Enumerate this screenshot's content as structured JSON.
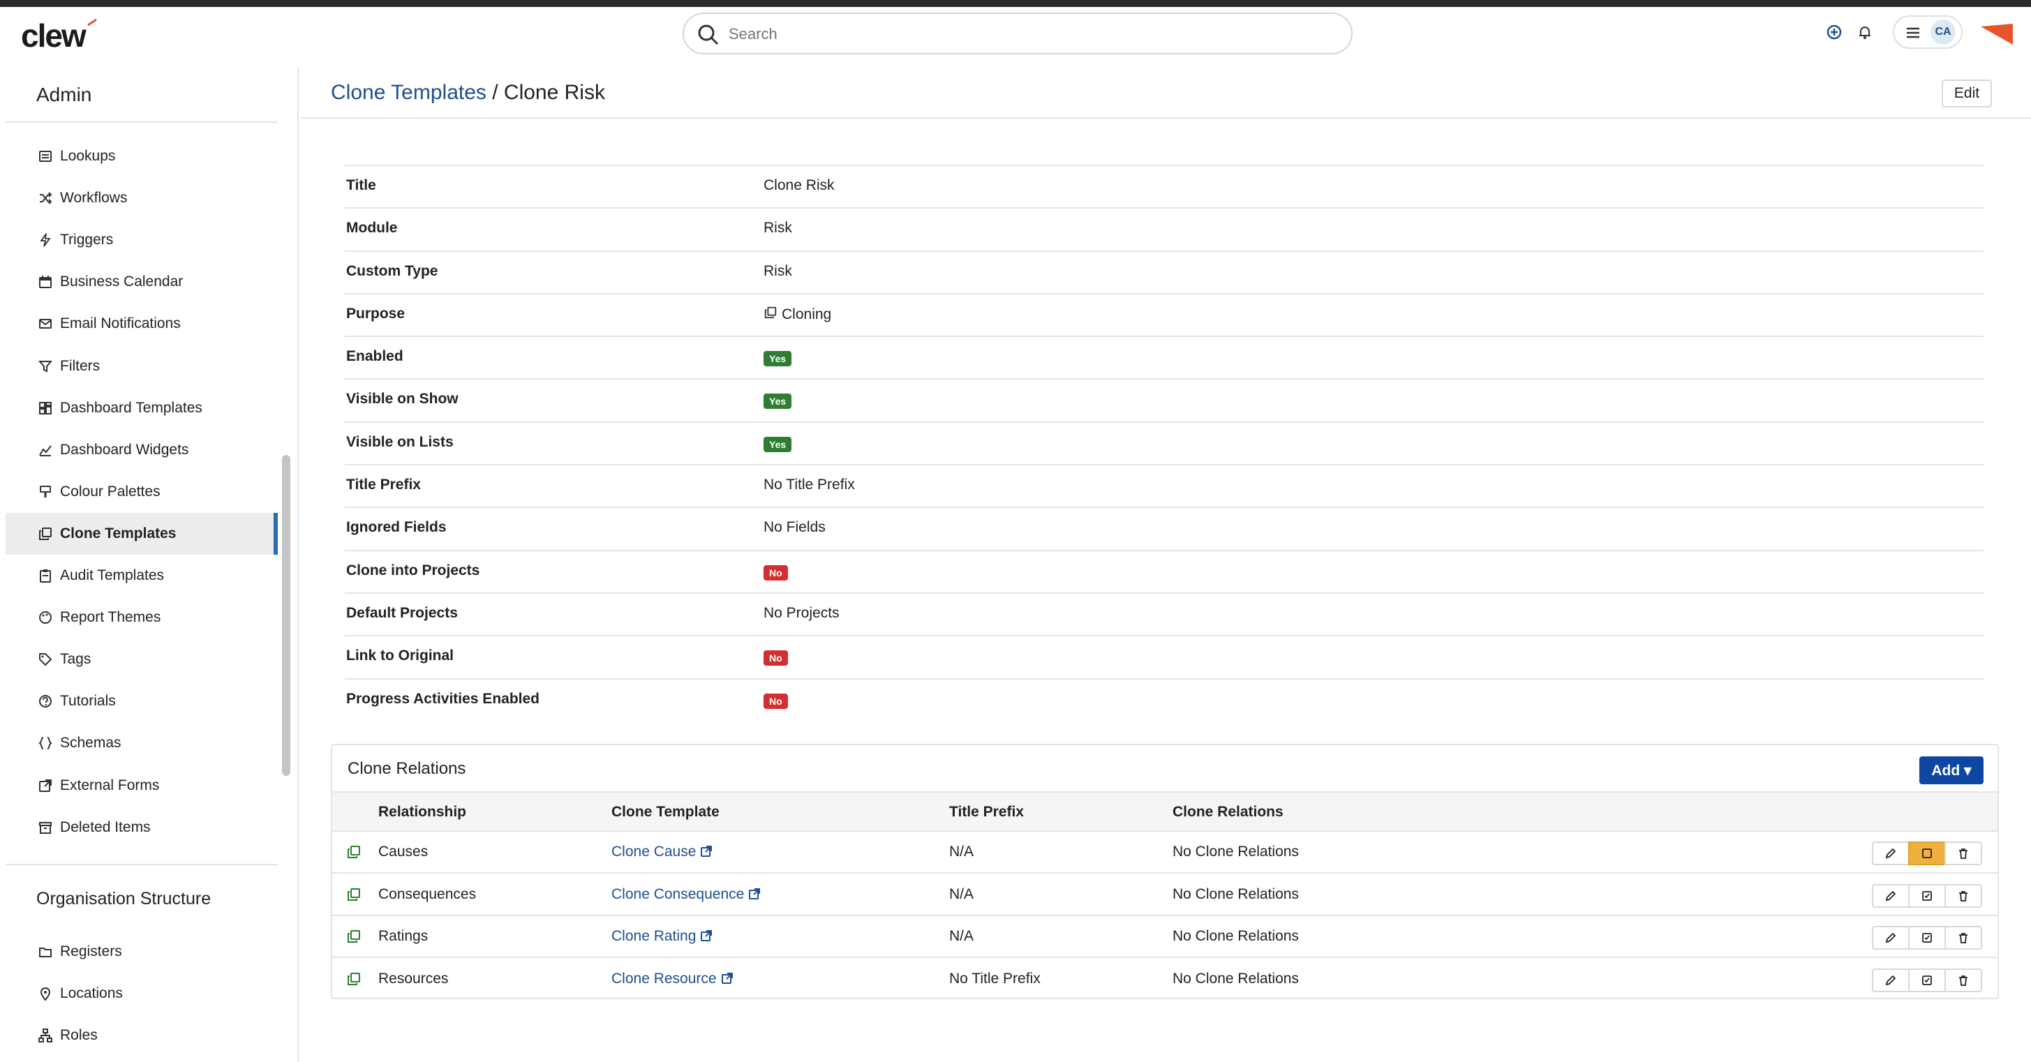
{
  "app": {
    "logo": "clew",
    "accent": "#1e4f8f",
    "brand_color": "#e8532c"
  },
  "search": {
    "placeholder": "Search"
  },
  "topbar": {
    "avatar_initials": "CA"
  },
  "sidebar": {
    "admin_heading": "Admin",
    "items": [
      {
        "label": "Lookups",
        "icon": "lookups-icon"
      },
      {
        "label": "Workflows",
        "icon": "shuffle-icon"
      },
      {
        "label": "Triggers",
        "icon": "lightning-icon"
      },
      {
        "label": "Business Calendar",
        "icon": "calendar-icon"
      },
      {
        "label": "Email Notifications",
        "icon": "envelope-icon"
      },
      {
        "label": "Filters",
        "icon": "funnel-icon"
      },
      {
        "label": "Dashboard Templates",
        "icon": "dashboard-icon"
      },
      {
        "label": "Dashboard Widgets",
        "icon": "chart-icon"
      },
      {
        "label": "Colour Palettes",
        "icon": "paint-icon"
      },
      {
        "label": "Clone Templates",
        "icon": "clone-icon",
        "active": true
      },
      {
        "label": "Audit Templates",
        "icon": "clipboard-icon"
      },
      {
        "label": "Report Themes",
        "icon": "palette-icon"
      },
      {
        "label": "Tags",
        "icon": "tag-icon"
      },
      {
        "label": "Tutorials",
        "icon": "question-icon"
      },
      {
        "label": "Schemas",
        "icon": "braces-icon"
      },
      {
        "label": "External Forms",
        "icon": "external-link-icon"
      },
      {
        "label": "Deleted Items",
        "icon": "archive-icon"
      }
    ],
    "org_heading": "Organisation Structure",
    "org_items": [
      {
        "label": "Registers",
        "icon": "folder-icon"
      },
      {
        "label": "Locations",
        "icon": "map-pin-icon"
      },
      {
        "label": "Roles",
        "icon": "hierarchy-icon"
      }
    ]
  },
  "header": {
    "breadcrumb_link": "Clone Templates",
    "separator": " / ",
    "current": "Clone Risk",
    "edit_label": "Edit"
  },
  "details": [
    {
      "label": "Title",
      "value": "Clone Risk",
      "type": "text"
    },
    {
      "label": "Module",
      "value": "Risk",
      "type": "text"
    },
    {
      "label": "Custom Type",
      "value": "Risk",
      "type": "text"
    },
    {
      "label": "Purpose",
      "value": "Cloning",
      "type": "purpose"
    },
    {
      "label": "Enabled",
      "value": "Yes",
      "type": "yes"
    },
    {
      "label": "Visible on Show",
      "value": "Yes",
      "type": "yes"
    },
    {
      "label": "Visible on Lists",
      "value": "Yes",
      "type": "yes"
    },
    {
      "label": "Title Prefix",
      "value": "No Title Prefix",
      "type": "text"
    },
    {
      "label": "Ignored Fields",
      "value": "No Fields",
      "type": "text"
    },
    {
      "label": "Clone into Projects",
      "value": "No",
      "type": "no"
    },
    {
      "label": "Default Projects",
      "value": "No Projects",
      "type": "text"
    },
    {
      "label": "Link to Original",
      "value": "No",
      "type": "no"
    },
    {
      "label": "Progress Activities Enabled",
      "value": "No",
      "type": "no"
    }
  ],
  "relations": {
    "title": "Clone Relations",
    "add_label": "Add",
    "columns": [
      "Relationship",
      "Clone Template",
      "Title Prefix",
      "Clone Relations"
    ],
    "rows": [
      {
        "relationship": "Causes",
        "template": "Clone Cause",
        "prefix": "N/A",
        "relations": "No Clone Relations",
        "highlight": true
      },
      {
        "relationship": "Consequences",
        "template": "Clone Consequence",
        "prefix": "N/A",
        "relations": "No Clone Relations"
      },
      {
        "relationship": "Ratings",
        "template": "Clone Rating",
        "prefix": "N/A",
        "relations": "No Clone Relations"
      },
      {
        "relationship": "Resources",
        "template": "Clone Resource",
        "prefix": "No Title Prefix",
        "relations": "No Clone Relations"
      }
    ]
  }
}
